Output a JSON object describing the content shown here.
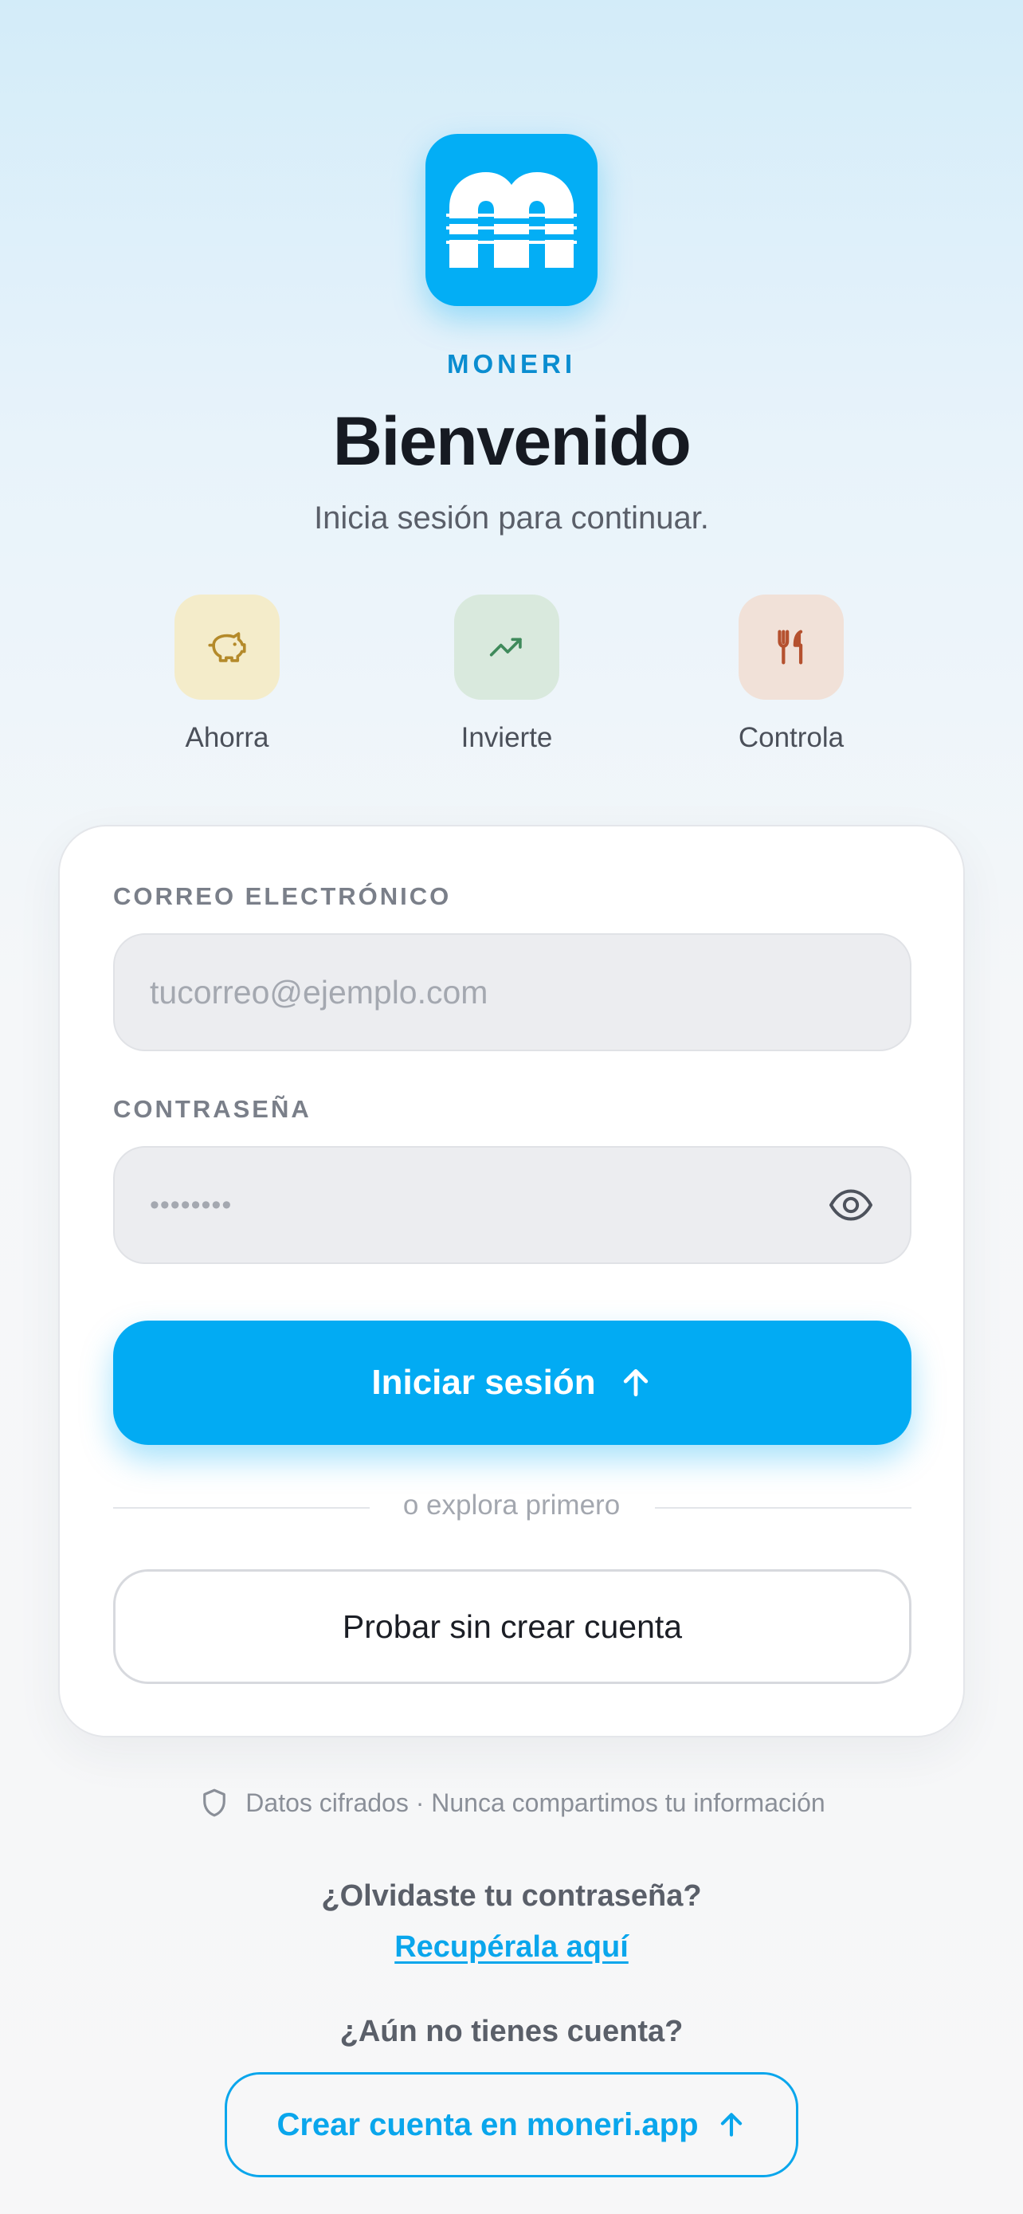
{
  "app": {
    "brand": "MONERI",
    "title": "Bienvenido",
    "subtitle": "Inicia sesión para continuar.",
    "accent": "#02abf3"
  },
  "features": [
    {
      "label": "Ahorra",
      "icon": "piggy-bank-icon",
      "bg": "#f4ecca",
      "color": "#b48a2a"
    },
    {
      "label": "Invierte",
      "icon": "trending-up-icon",
      "bg": "#d9e9dd",
      "color": "#3f8a5b"
    },
    {
      "label": "Controla",
      "icon": "fork-knife-icon",
      "bg": "#f1e1d8",
      "color": "#b5512f"
    }
  ],
  "form": {
    "email_label": "CORREO ELECTRÓNICO",
    "email_placeholder": "tucorreo@ejemplo.com",
    "password_label": "CONTRASEÑA",
    "password_value": "••••••••",
    "submit_label": "Iniciar sesión",
    "divider_text": "o explora primero",
    "guest_label": "Probar sin crear cuenta"
  },
  "footer": {
    "security_text": "Datos cifrados · Nunca compartimos tu información",
    "forgot_question": "¿Olvidaste tu contraseña?",
    "forgot_link": "Recupérala aquí",
    "no_account_question": "¿Aún no tienes cuenta?",
    "create_account_label": "Crear cuenta en moneri.app"
  }
}
